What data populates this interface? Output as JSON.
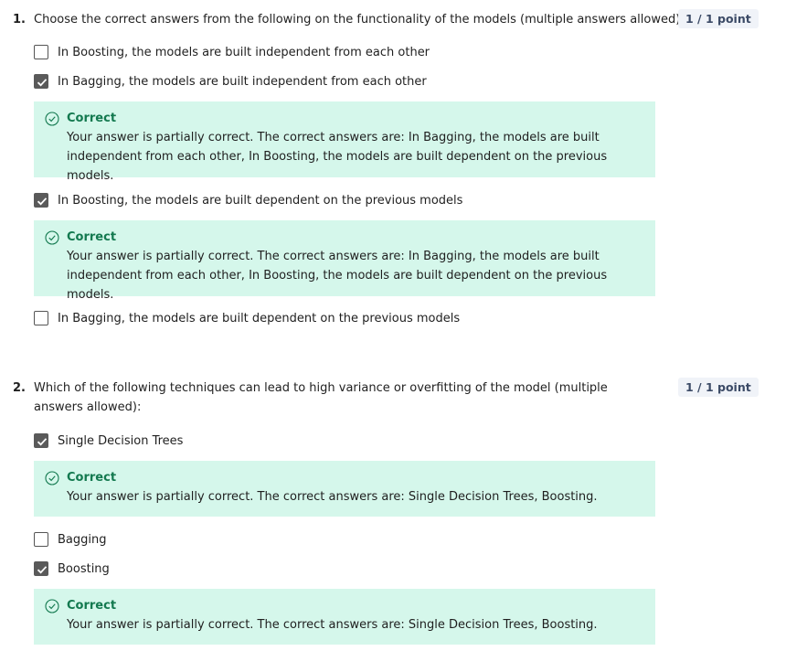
{
  "questions": [
    {
      "number": "1.",
      "text": "Choose the correct answers from the following on the functionality of the models (multiple answers allowed):",
      "points": "1 / 1 point",
      "options": [
        {
          "label": "In Boosting, the models are built independent from each other",
          "checked": false
        },
        {
          "label": "In Bagging, the models are built independent from each other",
          "checked": true,
          "feedback": {
            "title": "Correct",
            "text": "Your answer is partially correct. The correct answers are: In Bagging, the models are built independent from each other, In Boosting, the models are built dependent on the previous models."
          }
        },
        {
          "label": "In Boosting, the models are built dependent on the previous models",
          "checked": true,
          "feedback": {
            "title": "Correct",
            "text": "Your answer is partially correct. The correct answers are: In Bagging, the models are built independent from each other, In Boosting, the models are built dependent on the previous models."
          }
        },
        {
          "label": "In Bagging, the models are built dependent on the previous models",
          "checked": false
        }
      ]
    },
    {
      "number": "2.",
      "text": "Which of the following techniques can lead to high variance or overfitting of the model (multiple answers allowed):",
      "points": "1 / 1 point",
      "options": [
        {
          "label": "Single Decision Trees",
          "checked": true,
          "feedback": {
            "title": "Correct",
            "text": "Your answer is partially correct. The correct answers are: Single Decision Trees, Boosting."
          }
        },
        {
          "label": "Bagging",
          "checked": false
        },
        {
          "label": "Boosting",
          "checked": true,
          "feedback": {
            "title": "Correct",
            "text": "Your answer is partially correct. The correct answers are: Single Decision Trees, Boosting."
          }
        }
      ]
    }
  ],
  "colors": {
    "feedback_bg": "#d5f7eb",
    "correct_green": "#13794f",
    "points_bg": "#f0f3f8",
    "checkbox_checked": "#5a5a5a"
  }
}
